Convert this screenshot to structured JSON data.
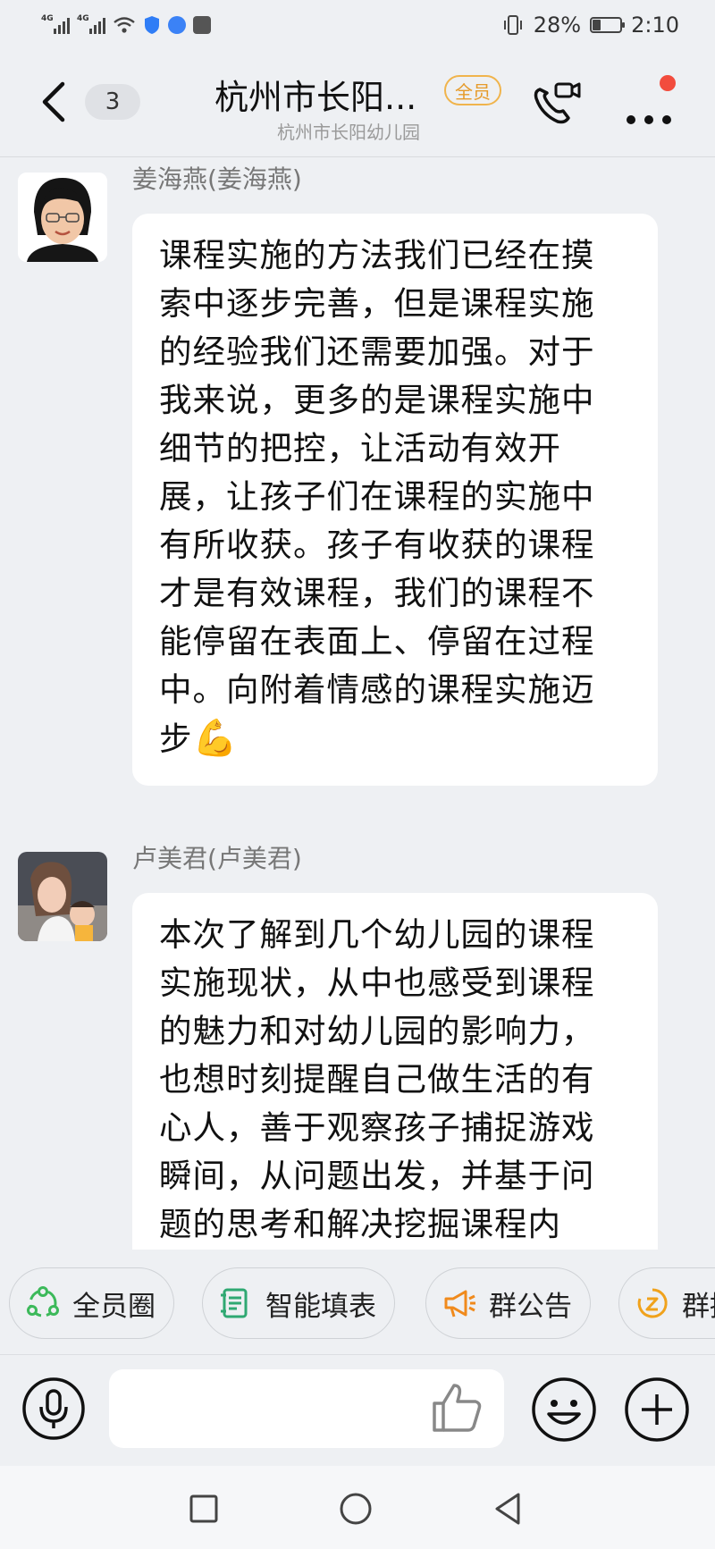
{
  "status_bar": {
    "signal1_label": "4G",
    "signal2_label": "4G",
    "battery_percent": "28%",
    "battery_level": 0.28,
    "time": "2:10"
  },
  "header": {
    "unread_count": "3",
    "title": "杭州市长阳...",
    "badge": "全员",
    "subtitle": "杭州市长阳幼儿园"
  },
  "messages": [
    {
      "sender": "姜海燕(姜海燕)",
      "lines": [
        "课程实施的方法我们已经在摸",
        "索中逐步完善，但是课程实施",
        "的经验我们还需要加强。对于",
        "我来说，更多的是课程实施中",
        "细节的把控，让活动有效开",
        "展，让孩子们在课程的实施中",
        "有所收获。孩子有收获的课程",
        "才是有效课程，我们的课程不",
        "能停留在表面上、停留在过程",
        "中。向附着情感的课程实施迈",
        "步"
      ],
      "emoji": "💪"
    },
    {
      "sender": "卢美君(卢美君)",
      "lines": [
        "本次了解到几个幼儿园的课程",
        "实施现状，从中也感受到课程",
        "的魅力和对幼儿园的影响力，",
        "也想时刻提醒自己做生活的有",
        "心人，善于观察孩子捕捉游戏",
        "瞬间，从问题出发，并基于问",
        "题的思考和解决挖掘课程内"
      ]
    }
  ],
  "quick_tools": [
    {
      "label": "全员圈",
      "icon": "circle-group-icon",
      "color": "#3cb95a"
    },
    {
      "label": "智能填表",
      "icon": "form-icon",
      "color": "#2fa872"
    },
    {
      "label": "群公告",
      "icon": "megaphone-icon",
      "color": "#f08a1c"
    },
    {
      "label": "群接龙",
      "icon": "relay-icon",
      "color": "#f0a21c"
    }
  ],
  "input_bar": {
    "mic_icon": "microphone-icon",
    "like_icon": "thumbs-up-icon",
    "emoji_icon": "smiley-icon",
    "plus_icon": "plus-icon"
  },
  "colors": {
    "background": "#eef0f3",
    "badge": "#e69b2b",
    "notification": "#f24c3d"
  }
}
